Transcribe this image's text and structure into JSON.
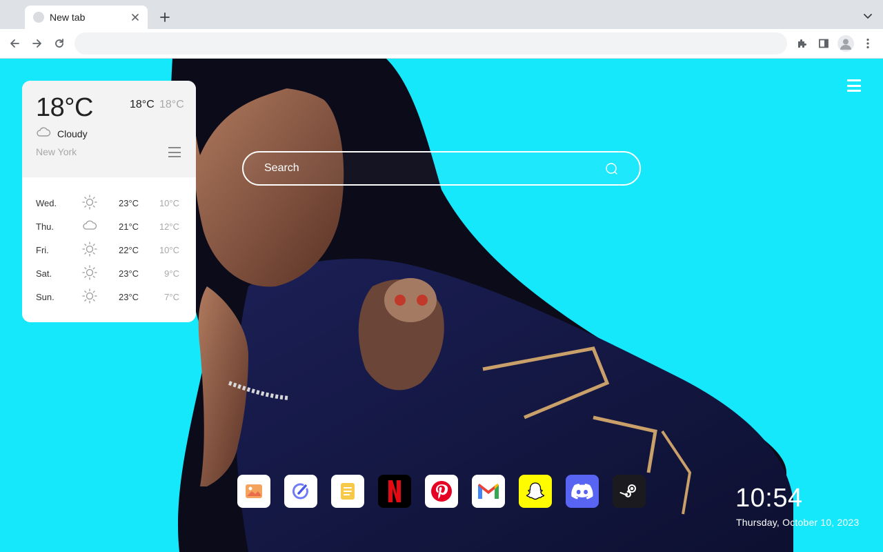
{
  "browser": {
    "tab_title": "New tab",
    "address_value": "",
    "address_placeholder": ""
  },
  "weather": {
    "current_temp": "18°C",
    "high": "18°C",
    "low": "18°C",
    "condition": "Cloudy",
    "condition_icon": "cloud-icon",
    "city": "New York",
    "forecast": [
      {
        "day": "Wed.",
        "icon": "sun-icon",
        "high": "23°C",
        "low": "10°C"
      },
      {
        "day": "Thu.",
        "icon": "cloud-icon",
        "high": "21°C",
        "low": "12°C"
      },
      {
        "day": "Fri.",
        "icon": "sun-icon",
        "high": "22°C",
        "low": "10°C"
      },
      {
        "day": "Sat.",
        "icon": "sun-icon",
        "high": "23°C",
        "low": "9°C"
      },
      {
        "day": "Sun.",
        "icon": "sun-icon",
        "high": "23°C",
        "low": "7°C"
      }
    ]
  },
  "search": {
    "placeholder": "Search"
  },
  "dock": {
    "apps": [
      {
        "name": "photos",
        "icon": "photos-icon"
      },
      {
        "name": "tasks",
        "icon": "tasks-icon"
      },
      {
        "name": "notes",
        "icon": "notes-icon"
      },
      {
        "name": "netflix",
        "icon": "netflix-icon"
      },
      {
        "name": "pinterest",
        "icon": "pinterest-icon"
      },
      {
        "name": "gmail",
        "icon": "gmail-icon"
      },
      {
        "name": "snapchat",
        "icon": "snapchat-icon"
      },
      {
        "name": "discord",
        "icon": "discord-icon"
      },
      {
        "name": "steam",
        "icon": "steam-icon"
      }
    ]
  },
  "clock": {
    "time": "10:54",
    "date": "Thursday, October 10, 2023"
  },
  "colors": {
    "background": "#15e8fb",
    "netflix_red": "#e50914",
    "pinterest_red": "#e60023",
    "snapchat_yellow": "#fffc00",
    "discord_blurple": "#5865f2"
  }
}
